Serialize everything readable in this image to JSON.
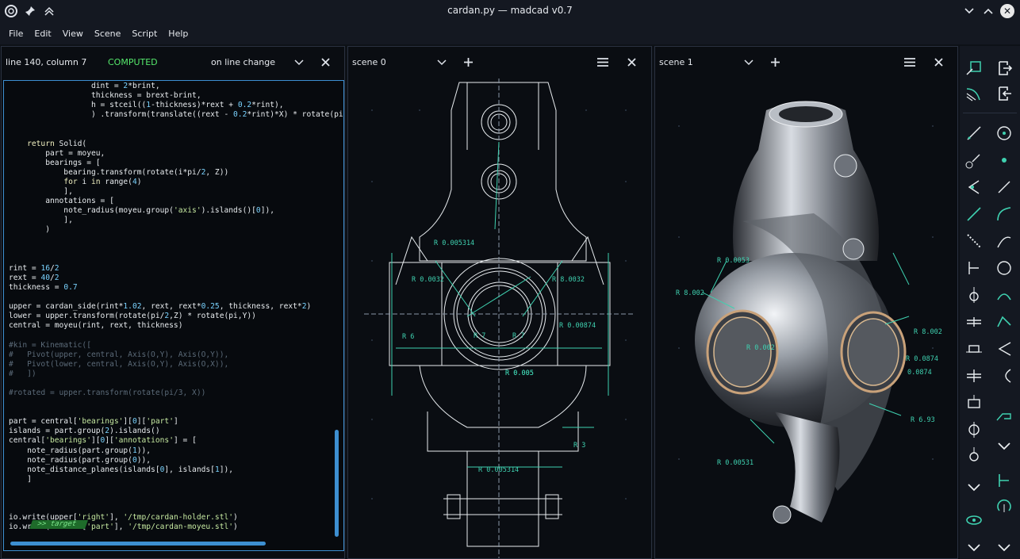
{
  "window": {
    "title": "cardan.py — madcad v0.7"
  },
  "menu": [
    "File",
    "Edit",
    "View",
    "Scene",
    "Script",
    "Help"
  ],
  "editor": {
    "position": "line 140, column 7",
    "status": "COMPUTED",
    "mode": "on line change",
    "target_label": ">>  target"
  },
  "scenes": [
    {
      "name": "scene 0"
    },
    {
      "name": "scene 1"
    }
  ],
  "scene0_annotations": [
    "R 0.005314",
    "R 0.0032",
    "R 8.0032",
    "R 7",
    "R 7",
    "R 0.005",
    "R 0.00874",
    "R 0.005",
    "R 6",
    "R 0.005314",
    "R 3"
  ],
  "scene1_annotations": [
    "R 0.0053",
    "R 8.002",
    "R 0.002",
    "R 8.002",
    "R 0.0874",
    "0.0874",
    "R 6.93",
    "R 0.00531"
  ],
  "icons": {
    "app": "madcad-logo-icon",
    "pin": "pin-icon",
    "collapse": "double-chevron-up-icon",
    "minimize": "chevron-down-icon",
    "maximize": "chevron-up-icon",
    "close": "close-icon"
  },
  "colors": {
    "accent": "#3d8fd1",
    "computed": "#55e86b",
    "annotation": "#3fd1b0"
  }
}
